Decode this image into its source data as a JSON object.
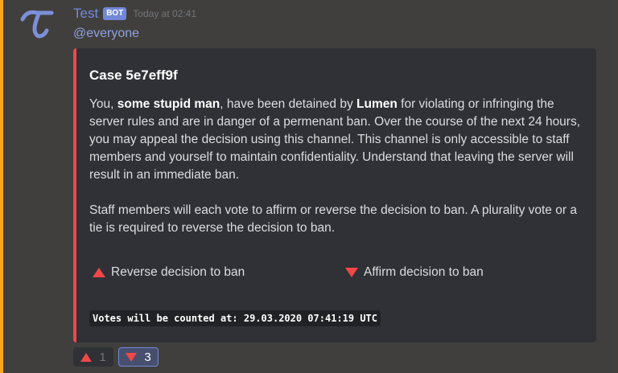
{
  "message": {
    "author": "Test",
    "bot_tag": "BOT",
    "timestamp": "Today at 02:41",
    "content": "@everyone",
    "avatar_icon": "tau-logo-icon",
    "mention_bar_color": "#faa61a"
  },
  "embed": {
    "color": "#f04747",
    "title": "Case 5e7eff9f",
    "description": {
      "p1_prefix": "You, ",
      "p1_user": "some stupid man",
      "p1_mid": ", have been detained by ",
      "p1_mod": "Lumen",
      "p1_suffix": " for violating or infringing the server rules and are in danger of a permenant ban. Over the course of the next 24 hours, you may appeal the decision using this channel. This channel is only accessible to staff members and yourself to maintain confidentiality. Understand that leaving the server will result in an immediate ban.",
      "p2": "Staff members will each vote to affirm or reverse the decision to ban. A plurality vote or a tie is required to reverse the decision to ban."
    },
    "fields": {
      "reverse": {
        "icon": "triangle-up-icon",
        "label": "Reverse decision to ban"
      },
      "affirm": {
        "icon": "triangle-down-icon",
        "label": "Affirm decision to ban"
      }
    },
    "footer": "Votes will be counted at: 29.03.2020 07:41:19 UTC"
  },
  "reactions": [
    {
      "icon": "triangle-up-icon",
      "count": "1",
      "reacted": false
    },
    {
      "icon": "triangle-down-icon",
      "count": "3",
      "reacted": true
    }
  ]
}
